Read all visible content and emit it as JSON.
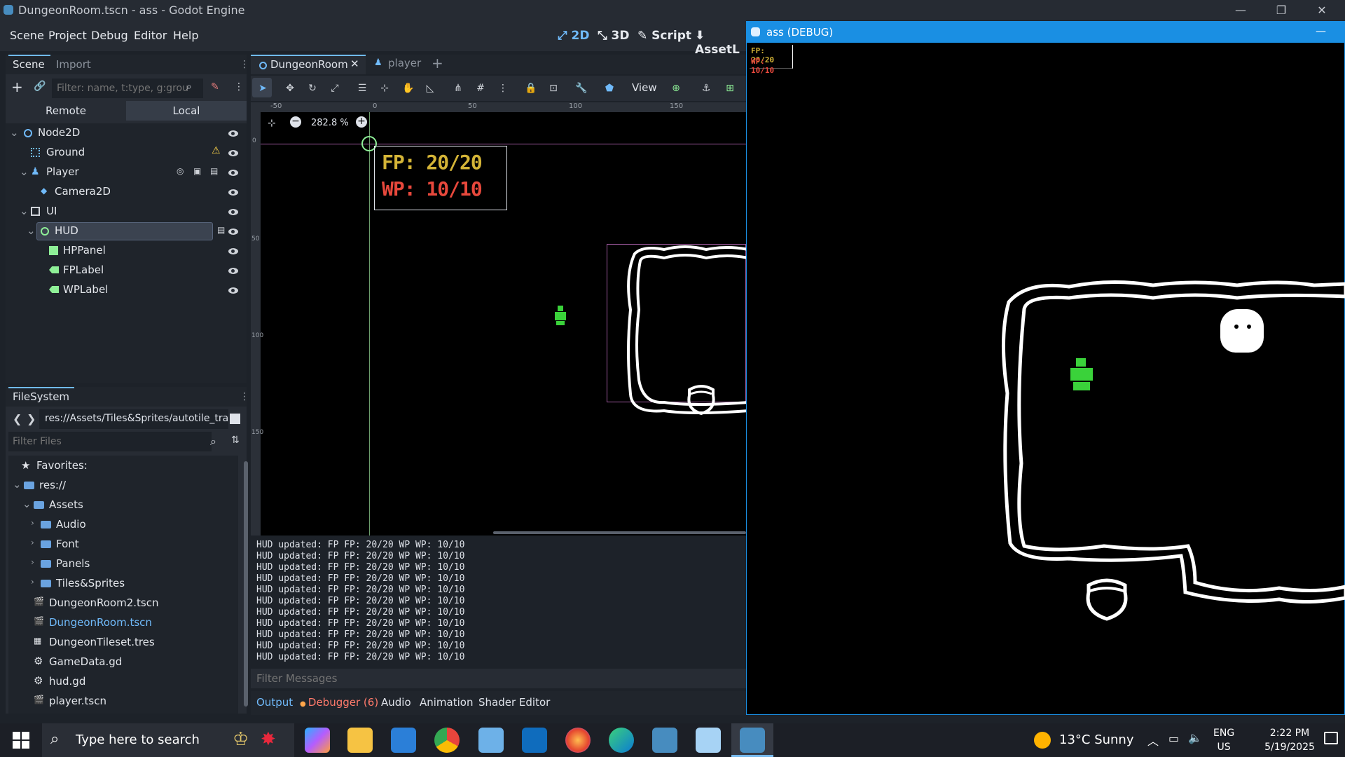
{
  "window": {
    "title": "DungeonRoom.tscn - ass - Godot Engine",
    "minimize": "—",
    "maximize": "❐",
    "close": "✕"
  },
  "menu": [
    "Scene",
    "Project",
    "Debug",
    "Editor",
    "Help"
  ],
  "modes": [
    "2D",
    "3D",
    "Script",
    "AssetL"
  ],
  "scene_panel": {
    "tabs": [
      "Scene",
      "Import"
    ],
    "filter_placeholder": "Filter: name, t:type, g:grou",
    "remote": "Remote",
    "local": "Local",
    "nodes": [
      "Node2D",
      "Ground",
      "Player",
      "Camera2D",
      "UI",
      "HUD",
      "HPPanel",
      "FPLabel",
      "WPLabel"
    ]
  },
  "filesystem": {
    "title": "FileSystem",
    "path": "res://Assets/Tiles&Sprites/autotile_tran",
    "filter_placeholder": "Filter Files",
    "items": [
      "Favorites:",
      "res://",
      "Assets",
      "Audio",
      "Font",
      "Panels",
      "Tiles&Sprites",
      "DungeonRoom2.tscn",
      "DungeonRoom.tscn",
      "DungeonTileset.tres",
      "GameData.gd",
      "hud.gd",
      "player.tscn"
    ]
  },
  "editor_tabs": [
    "DungeonRoom",
    "player"
  ],
  "toolbar": {
    "view": "View"
  },
  "viewport": {
    "zoom": "282.8 %",
    "ruler_labels": [
      "-50",
      "0",
      "50",
      "100",
      "150"
    ],
    "ruler_v_labels": [
      "0",
      "50",
      "100",
      "150"
    ],
    "hud_fp": "FP: 20/20",
    "hud_wp": "WP: 10/10"
  },
  "output": {
    "lines": [
      "HUD updated: FP FP: 20/20 WP WP: 10/10",
      "HUD updated: FP FP: 20/20 WP WP: 10/10",
      "HUD updated: FP FP: 20/20 WP WP: 10/10",
      "HUD updated: FP FP: 20/20 WP WP: 10/10",
      "HUD updated: FP FP: 20/20 WP WP: 10/10",
      "HUD updated: FP FP: 20/20 WP WP: 10/10",
      "HUD updated: FP FP: 20/20 WP WP: 10/10",
      "HUD updated: FP FP: 20/20 WP WP: 10/10",
      "HUD updated: FP FP: 20/20 WP WP: 10/10",
      "HUD updated: FP FP: 20/20 WP WP: 10/10",
      "HUD updated: FP FP: 20/20 WP WP: 10/10"
    ],
    "filter_placeholder": "Filter Messages",
    "bottom_tabs": [
      "Output",
      "Debugger (6)",
      "Audio",
      "Animation",
      "Shader Editor"
    ]
  },
  "debug_window": {
    "title": "ass (DEBUG)",
    "fp": "FP: 20/20",
    "wp": "WP: 10/10",
    "minimize": "—"
  },
  "taskbar": {
    "search_placeholder": "Type here to search",
    "weather": "13°C  Sunny",
    "lang": "ENG",
    "region": "US",
    "time": "2:22 PM",
    "date": "5/19/2025"
  },
  "colors": {
    "accent": "#70bafa",
    "fp": "#d4b437",
    "wp": "#e8483c",
    "player": "#3ad23a",
    "debug_title": "#1a8fe3"
  }
}
